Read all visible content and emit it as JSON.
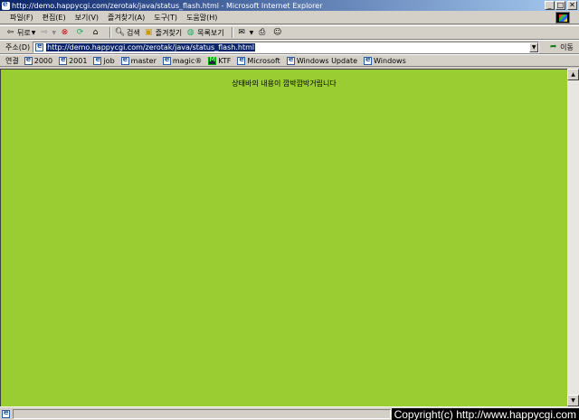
{
  "window": {
    "title": "http://demo.happycgi.com/zerotak/java/status_flash.html - Microsoft Internet Explorer",
    "buttons": {
      "minimize": "_",
      "maximize": "□",
      "close": "✕"
    }
  },
  "menu": {
    "items": [
      "파일(F)",
      "편집(E)",
      "보기(V)",
      "즐겨찾기(A)",
      "도구(T)",
      "도움말(H)"
    ]
  },
  "toolbar": {
    "back": "뒤로",
    "search": "검색",
    "favorites": "즐겨찾기",
    "history": "목록보기"
  },
  "address": {
    "label": "주소(D)",
    "url": "http://demo.happycgi.com/zerotak/java/status_flash.html",
    "go": "이동"
  },
  "links": {
    "label": "연결",
    "items": [
      "2000",
      "2001",
      "job",
      "master",
      "magic®",
      "KTF",
      "Microsoft",
      "Windows Update",
      "Windows"
    ]
  },
  "content": {
    "background": "#9acd32",
    "message": "상태바의 내용이 깜박깜박거립니다"
  },
  "statusbar": {
    "copyright": "Copyright(c) http://www.happycgi.com"
  }
}
